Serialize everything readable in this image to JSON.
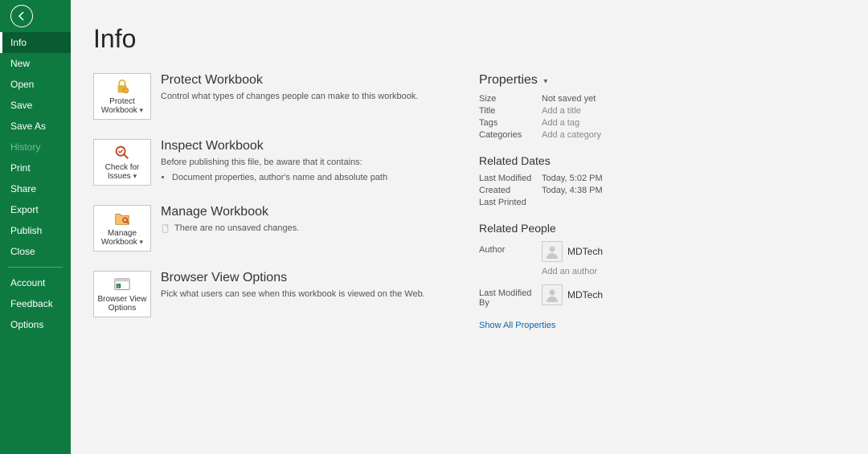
{
  "sidebar": {
    "items": [
      {
        "label": "Info",
        "active": true
      },
      {
        "label": "New"
      },
      {
        "label": "Open"
      },
      {
        "label": "Save"
      },
      {
        "label": "Save As"
      },
      {
        "label": "History",
        "disabled": true
      },
      {
        "label": "Print"
      },
      {
        "label": "Share"
      },
      {
        "label": "Export"
      },
      {
        "label": "Publish"
      },
      {
        "label": "Close"
      }
    ],
    "footer": [
      {
        "label": "Account"
      },
      {
        "label": "Feedback"
      },
      {
        "label": "Options"
      }
    ]
  },
  "page_title": "Info",
  "blocks": {
    "protect": {
      "button": "Protect Workbook",
      "title": "Protect Workbook",
      "caption": "Control what types of changes people can make to this workbook."
    },
    "inspect": {
      "button": "Check for Issues",
      "title": "Inspect Workbook",
      "caption": "Before publishing this file, be aware that it contains:",
      "bullets": [
        "Document properties, author's name and absolute path"
      ]
    },
    "manage": {
      "button": "Manage Workbook",
      "title": "Manage Workbook",
      "caption": "There are no unsaved changes."
    },
    "browser": {
      "button": "Browser View Options",
      "title": "Browser View Options",
      "caption": "Pick what users can see when this workbook is viewed on the Web."
    }
  },
  "properties": {
    "heading": "Properties",
    "rows": {
      "size": {
        "label": "Size",
        "value": "Not saved yet"
      },
      "title": {
        "label": "Title",
        "value": "Add a title",
        "placeholder": true
      },
      "tags": {
        "label": "Tags",
        "value": "Add a tag",
        "placeholder": true
      },
      "categories": {
        "label": "Categories",
        "value": "Add a category",
        "placeholder": true
      }
    }
  },
  "related_dates": {
    "heading": "Related Dates",
    "rows": {
      "last_modified": {
        "label": "Last Modified",
        "value": "Today, 5:02 PM"
      },
      "created": {
        "label": "Created",
        "value": "Today, 4:38 PM"
      },
      "last_printed": {
        "label": "Last Printed",
        "value": ""
      }
    }
  },
  "related_people": {
    "heading": "Related People",
    "author": {
      "label": "Author",
      "name": "MDTech"
    },
    "add_author": "Add an author",
    "last_modified_by": {
      "label": "Last Modified By",
      "name": "MDTech"
    }
  },
  "show_all": "Show All Properties"
}
